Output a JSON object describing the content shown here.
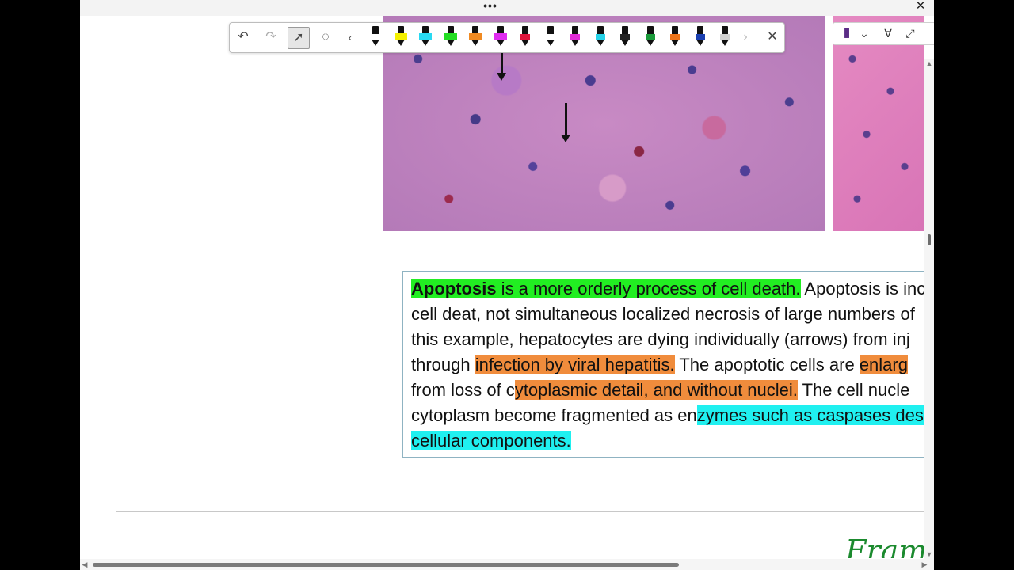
{
  "window": {
    "more_label": "•••",
    "close_label": "✕"
  },
  "toolbar": {
    "undo_icon": "↶",
    "redo_icon": "↷",
    "select_icon": "➚",
    "lasso_icon": "◌",
    "prev_icon": "‹",
    "next_icon": "›",
    "close_icon": "✕",
    "pens": [
      {
        "name": "pen-black",
        "color": "#ffffff",
        "highlighter": false
      },
      {
        "name": "highlighter-yellow",
        "color": "#f4f000",
        "highlighter": true
      },
      {
        "name": "highlighter-cyan",
        "color": "#29d9f2",
        "highlighter": true
      },
      {
        "name": "highlighter-green",
        "color": "#22dd22",
        "highlighter": true
      },
      {
        "name": "highlighter-orange",
        "color": "#f08a22",
        "highlighter": true
      },
      {
        "name": "highlighter-magenta",
        "color": "#e02bf0",
        "highlighter": true
      },
      {
        "name": "pen-red",
        "color": "#e0143c",
        "highlighter": false
      },
      {
        "name": "pen-white",
        "color": "#ffffff",
        "highlighter": false
      },
      {
        "name": "pen-magenta",
        "color": "#e22ad8",
        "highlighter": false
      },
      {
        "name": "pen-cyan",
        "color": "#26d2e8",
        "highlighter": false
      },
      {
        "name": "pen-dark",
        "color": "#222222",
        "highlighter": false
      },
      {
        "name": "pen-green",
        "color": "#1a9a3a",
        "highlighter": false
      },
      {
        "name": "pen-orange",
        "color": "#ef7418",
        "highlighter": false
      },
      {
        "name": "pen-blue",
        "color": "#1a3fb0",
        "highlighter": false
      },
      {
        "name": "pen-eraser",
        "color": "#d0d0d0",
        "highlighter": false
      }
    ]
  },
  "right_toolbar": {
    "book_icon": "▮",
    "chevron_icon": "⌄",
    "filter_icon": "∀",
    "expand_icon": "⤢"
  },
  "document": {
    "lines": [
      [
        {
          "t": "Apoptosis",
          "c": "hl-green bold"
        },
        {
          "t": " is a more orderly process of cell death.",
          "c": "hl-green"
        },
        {
          "t": " Apoptosis is inc",
          "c": ""
        }
      ],
      [
        {
          "t": "cell deat, not simultaneous localized necrosis of large numbers of",
          "c": ""
        }
      ],
      [
        {
          "t": "this example, hepatocytes are dying individually (arrows) from inj",
          "c": ""
        }
      ],
      [
        {
          "t": "through ",
          "c": ""
        },
        {
          "t": "infection by viral hepatitis.",
          "c": "hl-orange"
        },
        {
          "t": " The apoptotic cells are ",
          "c": ""
        },
        {
          "t": "enlarg",
          "c": "hl-orange"
        }
      ],
      [
        {
          "t": "from loss of c",
          "c": ""
        },
        {
          "t": "ytoplasmic detail, and without nuclei.",
          "c": "hl-orange"
        },
        {
          "t": " The cell nucle",
          "c": ""
        }
      ],
      [
        {
          "t": "cytoplasm become fragmented as en",
          "c": ""
        },
        {
          "t": "zymes such as caspases dest",
          "c": "hl-cyan"
        }
      ],
      [
        {
          "t": "cellular components.",
          "c": "hl-cyan"
        }
      ]
    ],
    "handwriting": "Frame"
  },
  "scrollbars": {
    "up": "▲",
    "down": "▼",
    "left": "◀",
    "right": "▶"
  }
}
